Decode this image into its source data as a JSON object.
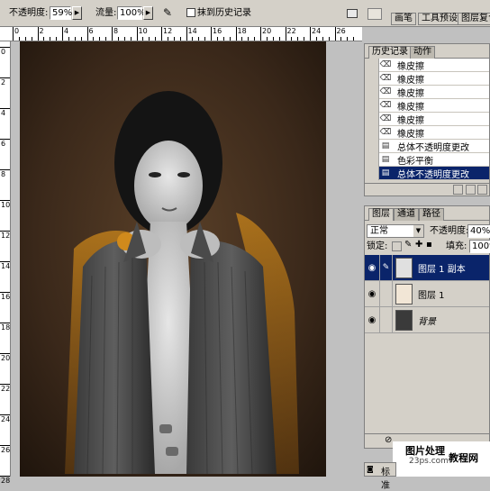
{
  "options_bar": {
    "opacity_label": "不透明度:",
    "opacity_value": "59%",
    "flow_label": "流量:",
    "flow_value": "100%",
    "erase_to_history_label": "抹到历史记录"
  },
  "palette_well": {
    "tabs": [
      "画笔",
      "工具预设",
      "图层复合"
    ]
  },
  "ruler": {
    "h_labels": [
      "0",
      "2",
      "4",
      "6",
      "8",
      "10",
      "12",
      "14",
      "16",
      "18",
      "20",
      "22",
      "24",
      "26"
    ],
    "v_labels": [
      "0",
      "2",
      "4",
      "6",
      "8",
      "10",
      "12",
      "14",
      "16",
      "18",
      "20",
      "22",
      "24",
      "26",
      "28"
    ]
  },
  "history_panel": {
    "tabs": [
      "历史记录",
      "动作"
    ],
    "items": [
      {
        "label": "橡皮擦",
        "icon": "eraser-icon"
      },
      {
        "label": "橡皮擦",
        "icon": "eraser-icon"
      },
      {
        "label": "橡皮擦",
        "icon": "eraser-icon"
      },
      {
        "label": "橡皮擦",
        "icon": "eraser-icon"
      },
      {
        "label": "橡皮擦",
        "icon": "eraser-icon"
      },
      {
        "label": "橡皮擦",
        "icon": "eraser-icon"
      },
      {
        "label": "总体不透明度更改",
        "icon": "document-icon"
      },
      {
        "label": "色彩平衡",
        "icon": "document-icon"
      },
      {
        "label": "总体不透明度更改",
        "icon": "document-icon",
        "selected": true
      }
    ]
  },
  "layers_panel": {
    "tabs": [
      "图层",
      "通道",
      "路径"
    ],
    "blend_mode": "正常",
    "opacity_label": "不透明度:",
    "opacity_value": "40%",
    "lock_label": "锁定:",
    "fill_label": "填充:",
    "fill_value": "100%",
    "layers": [
      {
        "name": "图层 1 副本",
        "selected": true
      },
      {
        "name": "图层 1",
        "selected": false
      },
      {
        "name": "背景",
        "selected": false,
        "italic": true
      }
    ]
  },
  "watermark": {
    "line1": "图片处理",
    "line2": "23ps.com",
    "line3": "教程网"
  },
  "status": {
    "label": "标准"
  }
}
